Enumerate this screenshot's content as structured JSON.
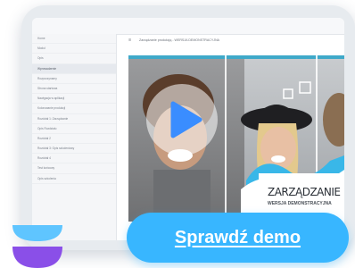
{
  "app": {
    "breadcrumb": "Zarządzanie produkcją - WERSJA DEMONSTRACYJNA"
  },
  "sidebar": {
    "items": [
      {
        "label": "Home"
      },
      {
        "label": "Moduł"
      },
      {
        "label": "Opis"
      },
      {
        "label": "Wprowadzenie",
        "active": true
      },
      {
        "label": "Rozpoczynamy"
      },
      {
        "label": "Strona startowa"
      },
      {
        "label": "Nawigacja w aplikacji"
      },
      {
        "label": "Kolorowanie produkcji"
      },
      {
        "label": "Rozdział 1: Zarządzanie"
      },
      {
        "label": "Opis Rozdziału"
      },
      {
        "label": "Rozdział 2"
      },
      {
        "label": "Rozdział 3: Opis szkoleniowy"
      },
      {
        "label": "Rozdział 4"
      },
      {
        "label": "Test końcowy"
      },
      {
        "label": "Opis szkolenia"
      }
    ]
  },
  "slide": {
    "title": "ZARZĄDZANIE",
    "subtitle": "WERSJA DEMONSTRACYJNA"
  },
  "player": {
    "play_icon": "play-icon",
    "accent": "#3a8dff"
  },
  "cta": {
    "label": "Sprawdź demo",
    "color": "#38b6ff"
  }
}
